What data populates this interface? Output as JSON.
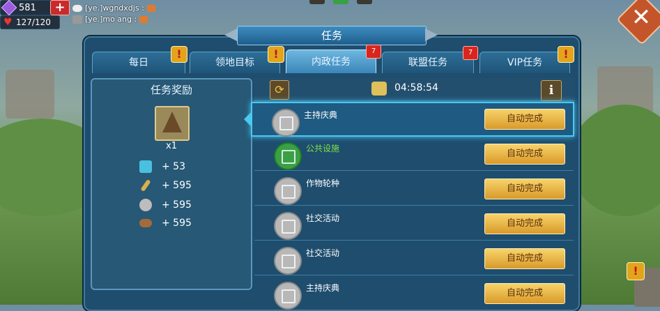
{
  "status": {
    "gems": "581",
    "hp": "127/120"
  },
  "chat": {
    "line1": "[ye.]wgndxdjs :",
    "line2": "[ye.]mo ang :"
  },
  "title": "任务",
  "tabs": [
    {
      "label": "每日"
    },
    {
      "label": "领地目标"
    },
    {
      "label": "内政任务",
      "count": "7"
    },
    {
      "label": "联盟任务",
      "count": "7"
    },
    {
      "label": "VIP任务"
    }
  ],
  "reward": {
    "title": "任务奖励",
    "quantity": "x1",
    "resources": [
      {
        "icon": "exp-icon",
        "value": "+ 53"
      },
      {
        "icon": "wheat-icon",
        "value": "+ 595"
      },
      {
        "icon": "stone-icon",
        "value": "+ 595"
      },
      {
        "icon": "wood-icon",
        "value": "+ 595"
      }
    ]
  },
  "timer": "04:58:54",
  "tasks": [
    {
      "name": "主持庆典",
      "button": "自动完成"
    },
    {
      "name": "公共设施",
      "button": "自动完成"
    },
    {
      "name": "作物轮种",
      "button": "自动完成"
    },
    {
      "name": "社交活动",
      "button": "自动完成"
    },
    {
      "name": "社交活动",
      "button": "自动完成"
    },
    {
      "name": "主持庆典",
      "button": "自动完成"
    }
  ],
  "colors": {
    "panel": "#1e4d6e",
    "button": "#e8b84a",
    "selected_outline": "#4cc8f0",
    "done_text": "#7ee04a"
  }
}
